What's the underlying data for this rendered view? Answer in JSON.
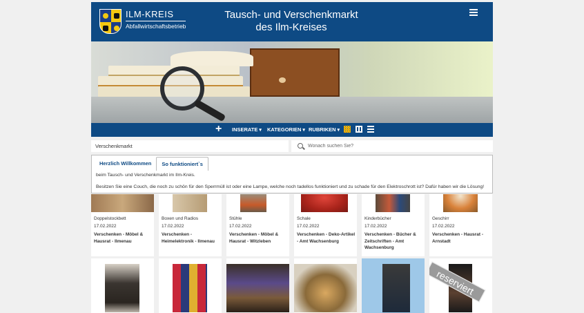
{
  "header": {
    "logo_title": "ILM-KREIS",
    "logo_subtitle": "Abfallwirtschaftsbetrieb",
    "title_line1": "Tausch- und Verschenkmarkt",
    "title_line2": "des Ilm-Kreises"
  },
  "nav": {
    "add_icon": "plus-icon",
    "items": [
      "INSERATE",
      "KATEGORIEN",
      "RUBRIKEN"
    ],
    "view_icons": [
      "grid-large-icon",
      "grid-small-icon",
      "list-icon"
    ]
  },
  "breadcrumb": "Verschenkmarkt",
  "search": {
    "placeholder": "Wonach suchen Sie?"
  },
  "info": {
    "tabs": [
      "Herzlich Willkommen",
      "So funktioniert`s"
    ],
    "line1": "beim Tausch- und Verschenkmarkt im Ilm-Kreis.",
    "line2": "Besitzen Sie eine Couch, die noch zu schön für den Sperrmüll ist oder eine Lampe, welche noch tadellos funktioniert und zu schade für den Elektroschrott ist? Dafür haben wir die Lösung!"
  },
  "listings_row1": [
    {
      "category": "Doppelstockbett",
      "date": "17.02.2022",
      "rubric": "Verschenken - Möbel & Hausrat - Ilmenau"
    },
    {
      "category": "Boxen und Radios",
      "date": "17.02.2022",
      "rubric": "Verschenken - Heimelektronik - Ilmenau"
    },
    {
      "category": "Stühle",
      "date": "17.02.2022",
      "rubric": "Verschenken - Möbel & Hausrat - Witzleben"
    },
    {
      "category": "Schale",
      "date": "17.02.2022",
      "rubric": "Verschenken - Deko-Artikel - Amt Wachsenburg"
    },
    {
      "category": "Kinderbücher",
      "date": "17.02.2022",
      "rubric": "Verschenken - Bücher & Zeitschriften - Amt Wachsenburg"
    },
    {
      "category": "Geschirr",
      "date": "17.02.2022",
      "rubric": "Verschenken - Hausrat - Arnstadt"
    }
  ],
  "reserved_label": "reserviert"
}
